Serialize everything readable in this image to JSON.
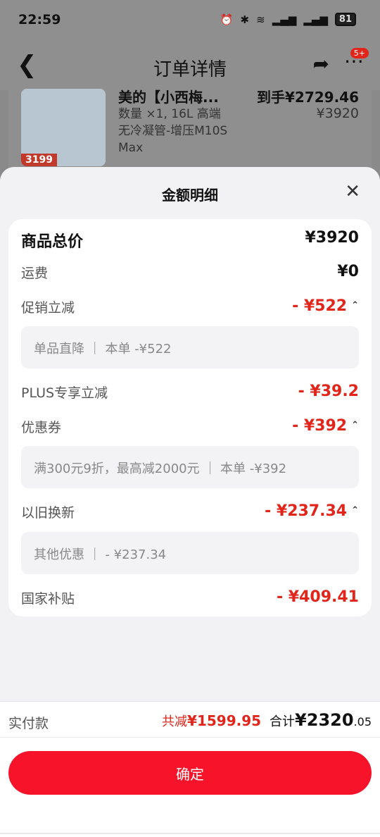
{
  "status_bar": {
    "time": "22:59",
    "battery": "81"
  },
  "header": {
    "title": "订单详情",
    "badge": "5+"
  },
  "product": {
    "name": "美的【小西梅...",
    "spec": "数量 ×1, 16L 高端无冷凝管-增压M10S Max",
    "arrive": "到手¥2729.46",
    "original_price": "¥3920",
    "image_price": "3199"
  },
  "sheet": {
    "title": "金额明细",
    "rows": {
      "total": {
        "label": "商品总价",
        "value": "¥3920"
      },
      "shipping": {
        "label": "运费",
        "value": "¥0"
      },
      "promo": {
        "label": "促销立减",
        "value": "- ¥522",
        "detail": "单品直降 ｜ 本单 -¥522"
      },
      "plus": {
        "label": "PLUS专享立减",
        "value": "- ¥39.2"
      },
      "coupon": {
        "label": "优惠券",
        "value": "- ¥392",
        "detail": "满300元9折，最高减2000元 ｜ 本单 -¥392"
      },
      "tradein": {
        "label": "以旧换新",
        "value": "- ¥237.34",
        "detail": "其他优惠 ｜ - ¥237.34"
      },
      "subsidy": {
        "label": "国家补贴",
        "value": "- ¥409.41"
      }
    }
  },
  "bottom": {
    "paid_label": "实付款",
    "reduce_label": "共减",
    "reduce_value": "¥1599.95",
    "sum_label": "合计",
    "sum_int": "¥2320",
    "sum_dec": ".05",
    "confirm": "确定"
  }
}
